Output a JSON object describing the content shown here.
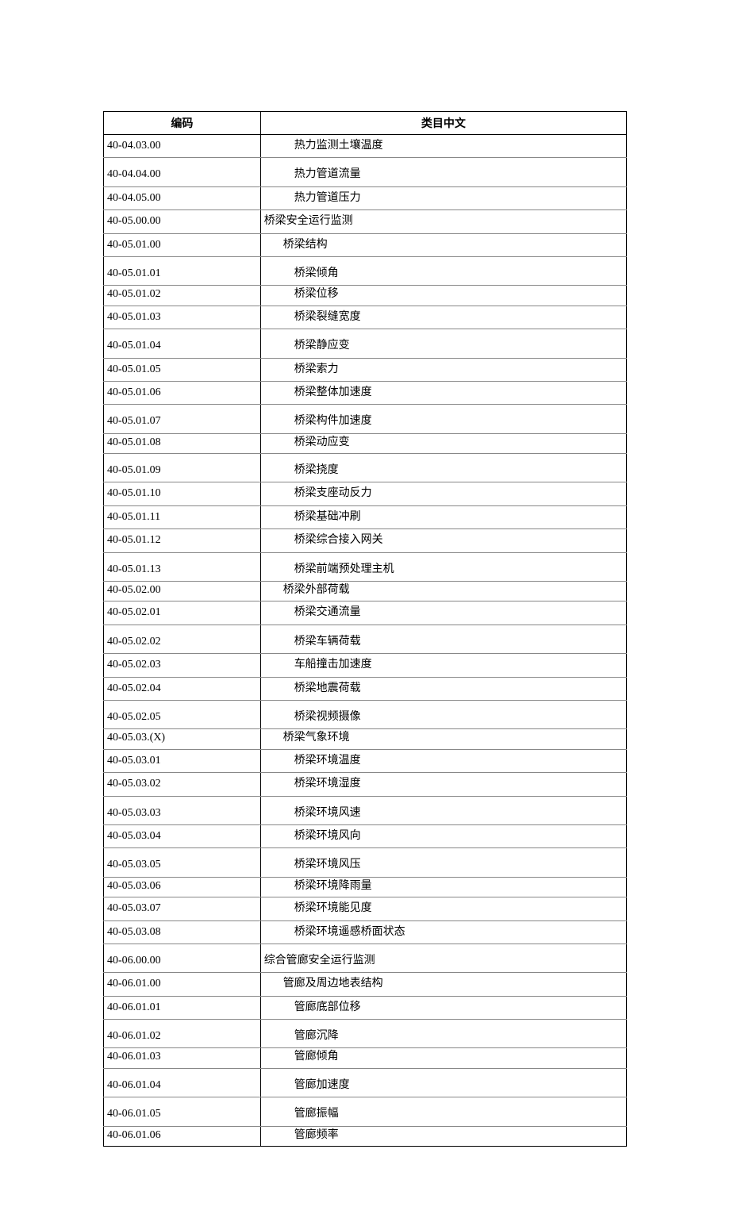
{
  "headers": {
    "code": "编码",
    "name": "类目中文"
  },
  "rows": [
    {
      "code": "40-04.03.00",
      "name": "热力监测土壤温度",
      "indent": 2,
      "rowClass": ""
    },
    {
      "code": "40-04.04.00",
      "name": "热力管道流量",
      "indent": 2,
      "rowClass": "tall"
    },
    {
      "code": "40-04.05.00",
      "name": "热力管道压力",
      "indent": 2,
      "rowClass": ""
    },
    {
      "code": "40-05.00.00",
      "name": "桥梁安全运行监测",
      "indent": 0,
      "rowClass": ""
    },
    {
      "code": "40-05.01.00",
      "name": "桥梁结构",
      "indent": 1,
      "rowClass": ""
    },
    {
      "code": "40-05.01.01",
      "name": "桥梁倾角",
      "indent": 2,
      "rowClass": "tall"
    },
    {
      "code": "40-05.01.02",
      "name": "桥梁位移",
      "indent": 2,
      "rowClass": "short"
    },
    {
      "code": "40-05.01.03",
      "name": "桥梁裂缝宽度",
      "indent": 2,
      "rowClass": ""
    },
    {
      "code": "40-05.01.04",
      "name": "桥梁静应变",
      "indent": 2,
      "rowClass": "tall"
    },
    {
      "code": "40-05.01.05",
      "name": "桥梁索力",
      "indent": 2,
      "rowClass": ""
    },
    {
      "code": "40-05.01.06",
      "name": "桥梁整体加速度",
      "indent": 2,
      "rowClass": ""
    },
    {
      "code": "40-05.01.07",
      "name": "桥梁构件加速度",
      "indent": 2,
      "rowClass": "tall"
    },
    {
      "code": "40-05.01.08",
      "name": "桥梁动应变",
      "indent": 2,
      "rowClass": "short"
    },
    {
      "code": "40-05.01.09",
      "name": "桥梁挠度",
      "indent": 2,
      "rowClass": "tall"
    },
    {
      "code": "40-05.01.10",
      "name": "桥梁支座动反力",
      "indent": 2,
      "rowClass": ""
    },
    {
      "code": "40-05.01.11",
      "name": "桥梁基础冲刷",
      "indent": 2,
      "rowClass": ""
    },
    {
      "code": "40-05.01.12",
      "name": "桥梁综合接入网关",
      "indent": 2,
      "rowClass": ""
    },
    {
      "code": "40-05.01.13",
      "name": "桥梁前端预处理主机",
      "indent": 2,
      "rowClass": "tall"
    },
    {
      "code": "40-05.02.00",
      "name": "桥梁外部荷载",
      "indent": 1,
      "rowClass": "short"
    },
    {
      "code": "40-05.02.01",
      "name": "桥梁交通流量",
      "indent": 2,
      "rowClass": ""
    },
    {
      "code": "40-05.02.02",
      "name": "桥梁车辆荷载",
      "indent": 2,
      "rowClass": "tall"
    },
    {
      "code": "40-05.02.03",
      "name": "车船撞击加速度",
      "indent": 2,
      "rowClass": ""
    },
    {
      "code": "40-05.02.04",
      "name": "桥梁地震荷载",
      "indent": 2,
      "rowClass": ""
    },
    {
      "code": "40-05.02.05",
      "name": "桥梁视频摄像",
      "indent": 2,
      "rowClass": "tall"
    },
    {
      "code": "40-05.03.(X)",
      "name": "桥梁气象环境",
      "indent": 1,
      "rowClass": "short"
    },
    {
      "code": "40-05.03.01",
      "name": "桥梁环境温度",
      "indent": 2,
      "rowClass": ""
    },
    {
      "code": "40-05.03.02",
      "name": "桥梁环境湿度",
      "indent": 2,
      "rowClass": ""
    },
    {
      "code": "40-05.03.03",
      "name": "桥梁环境风速",
      "indent": 2,
      "rowClass": "tall"
    },
    {
      "code": "40-05.03.04",
      "name": "桥梁环境风向",
      "indent": 2,
      "rowClass": ""
    },
    {
      "code": "40-05.03.05",
      "name": "桥梁环境风压",
      "indent": 2,
      "rowClass": "tall"
    },
    {
      "code": "40-05.03.06",
      "name": "桥梁环境降雨量",
      "indent": 2,
      "rowClass": "short"
    },
    {
      "code": "40-05.03.07",
      "name": "桥梁环境能见度",
      "indent": 2,
      "rowClass": ""
    },
    {
      "code": "40-05.03.08",
      "name": "桥梁环境遥感桥面状态",
      "indent": 2,
      "rowClass": ""
    },
    {
      "code": "40-06.00.00",
      "name": "综合管廊安全运行监测",
      "indent": 0,
      "rowClass": "tall"
    },
    {
      "code": "40-06.01.00",
      "name": "管廊及周边地表结构",
      "indent": 1,
      "rowClass": ""
    },
    {
      "code": "40-06.01.01",
      "name": "管廊底部位移",
      "indent": 2,
      "rowClass": ""
    },
    {
      "code": "40-06.01.02",
      "name": "管廊沉降",
      "indent": 2,
      "rowClass": "tall"
    },
    {
      "code": "40-06.01.03",
      "name": "管廊倾角",
      "indent": 2,
      "rowClass": "short"
    },
    {
      "code": "40-06.01.04",
      "name": "管廊加速度",
      "indent": 2,
      "rowClass": "tall"
    },
    {
      "code": "40-06.01.05",
      "name": "管廊振幅",
      "indent": 2,
      "rowClass": "tall"
    },
    {
      "code": "40-06.01.06",
      "name": "管廊频率",
      "indent": 2,
      "rowClass": "short"
    }
  ]
}
